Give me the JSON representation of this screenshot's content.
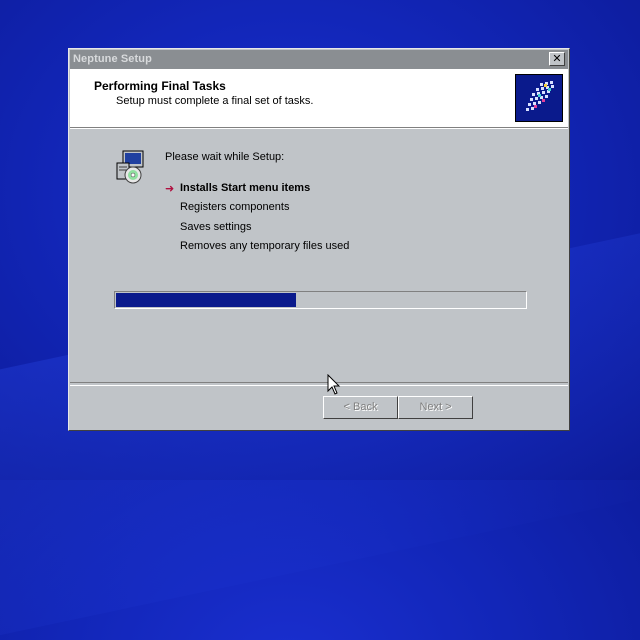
{
  "window": {
    "title": "Neptune Setup",
    "close_glyph": "✕"
  },
  "header": {
    "title": "Performing Final Tasks",
    "subtitle": "Setup must complete a final set of tasks.",
    "logo_icon": "setup-grid-logo-icon"
  },
  "body": {
    "intro": "Please wait while Setup:",
    "current_marker": "➜",
    "tasks": [
      {
        "label": "Installs Start menu items",
        "active": true
      },
      {
        "label": "Registers components",
        "active": false
      },
      {
        "label": "Saves settings",
        "active": false
      },
      {
        "label": "Removes any temporary files used",
        "active": false
      }
    ]
  },
  "progress": {
    "fraction": 0.44
  },
  "buttons": {
    "back": "< Back",
    "next": "Next >"
  },
  "colors": {
    "accent": "#0a1a8c",
    "arrow": "#b01040"
  }
}
